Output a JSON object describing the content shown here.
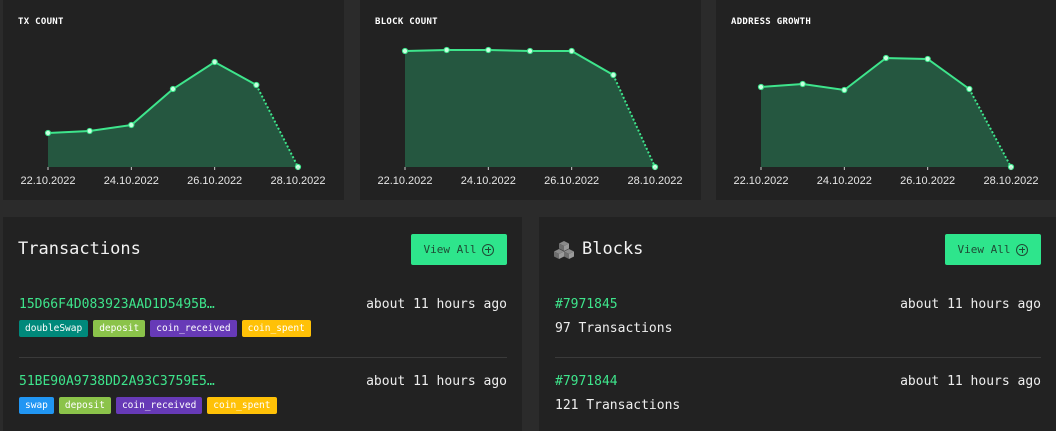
{
  "colors": {
    "accent": "#2ee58c",
    "line": "#3ee58c",
    "fill": "#255740",
    "card": "#222222",
    "page": "#2b2b2b"
  },
  "chart_data": [
    {
      "type": "area",
      "title": "TX COUNT",
      "x": [
        "22.10.2022",
        "23.10.2022",
        "24.10.2022",
        "25.10.2022",
        "26.10.2022",
        "27.10.2022",
        "28.10.2022"
      ],
      "tick_labels": [
        "22.10.2022",
        "24.10.2022",
        "26.10.2022",
        "28.10.2022"
      ],
      "values": [
        34,
        36,
        42,
        78,
        105,
        82,
        0
      ],
      "ylim": [
        0,
        127
      ],
      "last_segment": "dotted",
      "grid": false
    },
    {
      "type": "area",
      "title": "BLOCK COUNT",
      "x": [
        "22.10.2022",
        "23.10.2022",
        "24.10.2022",
        "25.10.2022",
        "26.10.2022",
        "27.10.2022",
        "28.10.2022"
      ],
      "tick_labels": [
        "22.10.2022",
        "24.10.2022",
        "26.10.2022",
        "28.10.2022"
      ],
      "values": [
        116,
        117,
        117,
        116,
        116,
        92,
        0
      ],
      "ylim": [
        0,
        127
      ],
      "last_segment": "dotted",
      "grid": false
    },
    {
      "type": "area",
      "title": "ADDRESS GROWTH",
      "x": [
        "22.10.2022",
        "23.10.2022",
        "24.10.2022",
        "25.10.2022",
        "26.10.2022",
        "27.10.2022",
        "28.10.2022"
      ],
      "tick_labels": [
        "22.10.2022",
        "24.10.2022",
        "26.10.2022",
        "28.10.2022"
      ],
      "values": [
        80,
        83,
        77,
        109,
        108,
        78,
        0
      ],
      "ylim": [
        0,
        127
      ],
      "last_segment": "dotted",
      "grid": false
    }
  ],
  "transactions": {
    "title": "Transactions",
    "view_all": "View All",
    "items": [
      {
        "hash": "15D66F4D083923AAD1D5495B…",
        "time": "about 11 hours ago",
        "tags": [
          {
            "label": "doubleSwap",
            "color": "#00897b"
          },
          {
            "label": "deposit",
            "color": "#8bc34a"
          },
          {
            "label": "coin_received",
            "color": "#673ab7"
          },
          {
            "label": "coin_spent",
            "color": "#ffc107"
          }
        ]
      },
      {
        "hash": "51BE90A9738DD2A93C3759E5…",
        "time": "about 11 hours ago",
        "tags": [
          {
            "label": "swap",
            "color": "#2196f3"
          },
          {
            "label": "deposit",
            "color": "#8bc34a"
          },
          {
            "label": "coin_received",
            "color": "#673ab7"
          },
          {
            "label": "coin_spent",
            "color": "#ffc107"
          }
        ]
      }
    ]
  },
  "blocks": {
    "title": "Blocks",
    "view_all": "View All",
    "items": [
      {
        "height": "#7971845",
        "time": "about 11 hours ago",
        "txs": "97 Transactions"
      },
      {
        "height": "#7971844",
        "time": "about 11 hours ago",
        "txs": "121 Transactions"
      }
    ]
  }
}
